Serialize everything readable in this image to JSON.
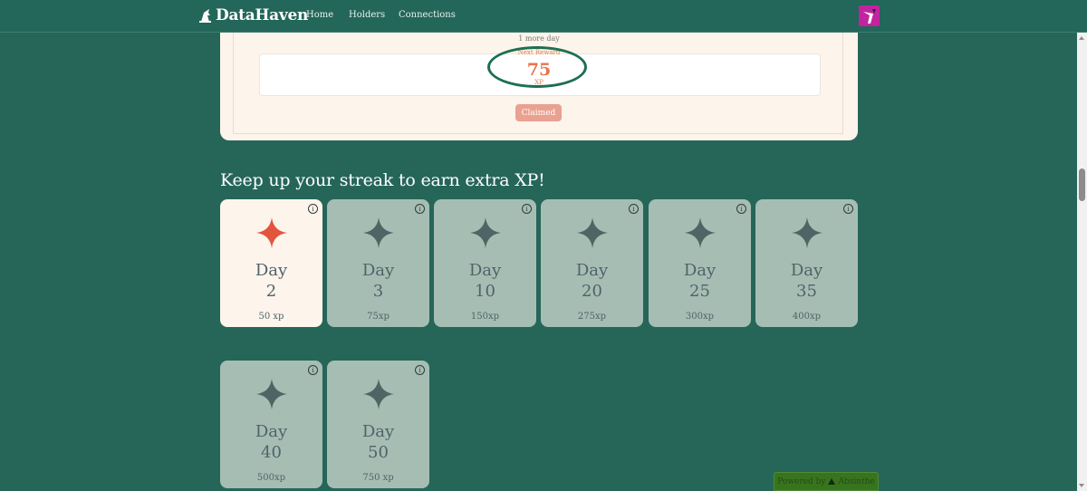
{
  "nav": {
    "brand": "DataHaven",
    "links": [
      "Home",
      "Holders",
      "Connections"
    ],
    "avatar_color": "#c2249f"
  },
  "reward": {
    "one_more_day": "1 more day",
    "next_reward_label": "Next Reward",
    "xp_value": "75",
    "xp_unit": "XP",
    "claimed_label": "Claimed"
  },
  "streak": {
    "heading": "Keep up your streak to earn extra XP!",
    "cards": [
      {
        "label": "Day",
        "day": "2",
        "xp": "50 xp",
        "active": true
      },
      {
        "label": "Day",
        "day": "3",
        "xp": "75xp",
        "active": false
      },
      {
        "label": "Day",
        "day": "10",
        "xp": "150xp",
        "active": false
      },
      {
        "label": "Day",
        "day": "20",
        "xp": "275xp",
        "active": false
      },
      {
        "label": "Day",
        "day": "25",
        "xp": "300xp",
        "active": false
      },
      {
        "label": "Day",
        "day": "35",
        "xp": "400xp",
        "active": false
      },
      {
        "label": "Day",
        "day": "40",
        "xp": "500xp",
        "active": false
      },
      {
        "label": "Day",
        "day": "50",
        "xp": "750 xp",
        "active": false
      }
    ],
    "info_icon": "info-icon",
    "star_icon": "sparkle-star-icon",
    "active_star_color": "#e2553f",
    "inactive_star_color": "#4f6565"
  },
  "footer": {
    "powered_by": "Powered by",
    "brand": "Absinthe"
  },
  "colors": {
    "page_bg": "#256658",
    "card_bg": "#fdf4ec",
    "inactive_card_bg": "#a6bdb3",
    "accent": "#e9744d",
    "highlight_ring": "#1d6f52"
  }
}
